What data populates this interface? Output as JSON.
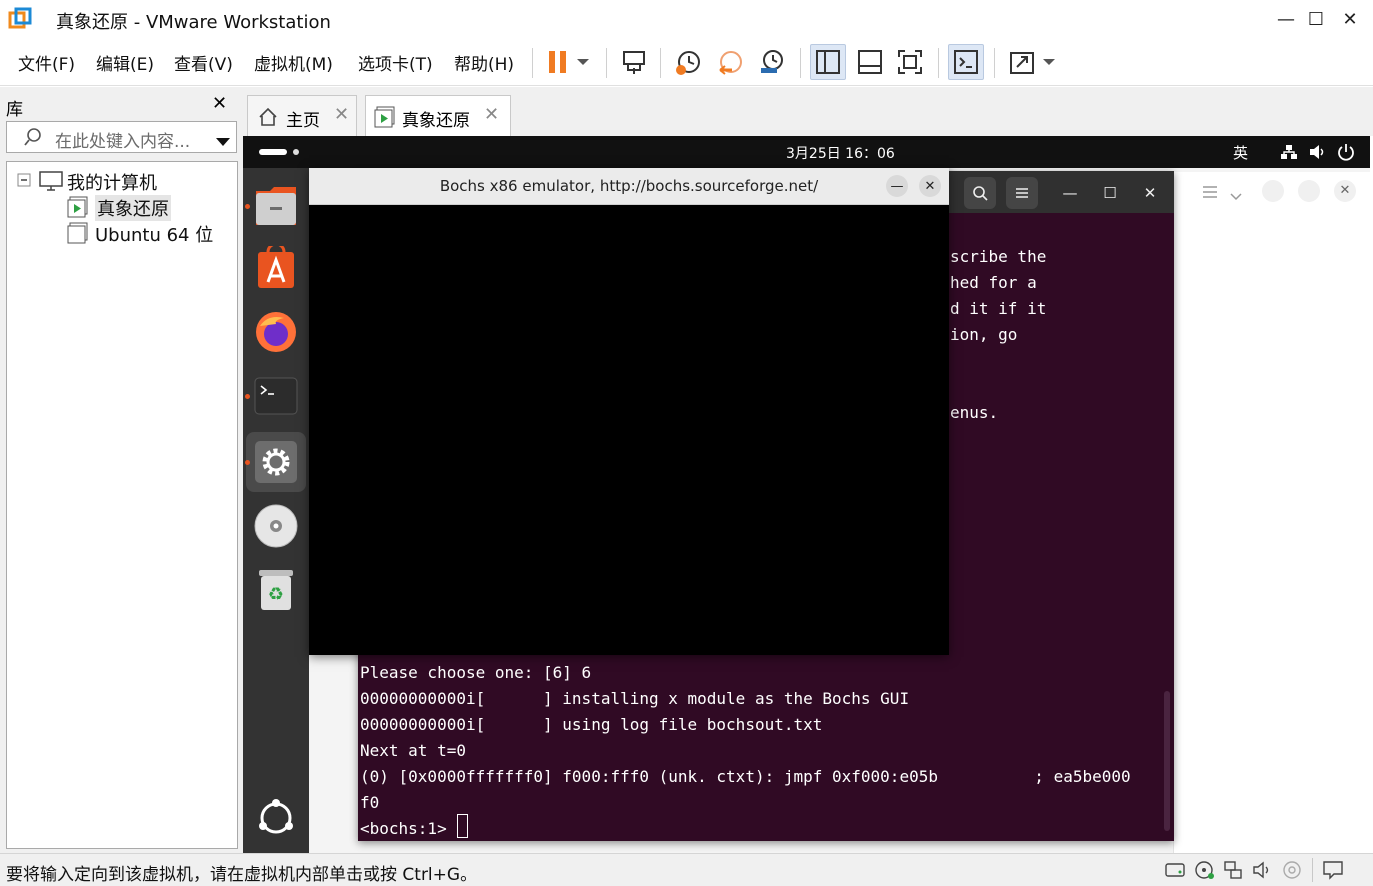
{
  "window": {
    "title": "真象还原 - VMware Workstation",
    "controls": {
      "minimize": "—",
      "maximize": "☐",
      "close": "✕"
    }
  },
  "menubar": {
    "items": [
      "文件(F)",
      "编辑(E)",
      "查看(V)",
      "虚拟机(M)",
      "选项卡(T)",
      "帮助(H)"
    ],
    "toolbar_icons": [
      "pause-icon",
      "dropdown-icon",
      "send-ctrl-alt-del-icon",
      "snapshot-icon",
      "revert-snapshot-icon",
      "snapshot-manager-icon",
      "library-view-icon",
      "thumbnail-view-icon",
      "full-screen-icon",
      "console-view-icon",
      "unity-icon"
    ]
  },
  "library": {
    "title": "库",
    "close": "✕",
    "search_placeholder": "在此处键入内容...",
    "tree": {
      "root": "我的计算机",
      "items": [
        "真象还原",
        "Ubuntu 64 位"
      ]
    }
  },
  "tabs": [
    {
      "label": "主页",
      "close": "✕"
    },
    {
      "label": "真象还原",
      "close": "✕"
    }
  ],
  "guest": {
    "clock": "3月25日  16：06",
    "input_method": "英",
    "dock_apps": [
      "files-icon",
      "app-center-icon",
      "firefox-icon",
      "terminal-icon",
      "settings-icon",
      "disc-icon",
      "trash-icon",
      "show-apps-icon"
    ],
    "bochs": {
      "title": "Bochs x86 emulator, http://bochs.sourceforge.net/",
      "minimize": "—",
      "close": "✕"
    },
    "terminal": {
      "background_lines": [
        "scribe the",
        "hed for a",
        "d it if it",
        "ion, go",
        "enus."
      ],
      "lines": [
        "Please choose one: [6] 6",
        "00000000000i[      ] installing x module as the Bochs GUI",
        "00000000000i[      ] using log file bochsout.txt",
        "Next at t=0",
        "(0) [0x0000fffffff0] f000:fff0 (unk. ctxt): jmpf 0xf000:e05b          ; ea5be000",
        "f0",
        "<bochs:1> "
      ],
      "buttons": {
        "minimize": "—",
        "maximize": "☐",
        "close": "✕"
      }
    }
  },
  "statusbar": {
    "text": "要将输入定向到该虚拟机，请在虚拟机内部单击或按 Ctrl+G。"
  },
  "colors": {
    "terminal_bg": "#300a24",
    "dock_bg": "#333333",
    "pause_orange": "#f07b22",
    "accent_blue": "#2b6cb0"
  }
}
